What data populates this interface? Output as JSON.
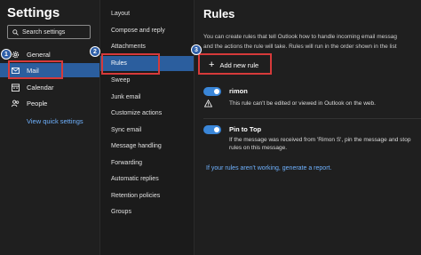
{
  "settings": {
    "title": "Settings",
    "search_placeholder": "Search settings",
    "nav": [
      {
        "label": "General",
        "icon": "gear-icon"
      },
      {
        "label": "Mail",
        "icon": "mail-icon",
        "selected": true
      },
      {
        "label": "Calendar",
        "icon": "calendar-icon"
      },
      {
        "label": "People",
        "icon": "people-icon"
      }
    ],
    "quick_settings_link": "View quick settings"
  },
  "mail_nav": [
    {
      "label": "Layout"
    },
    {
      "label": "Compose and reply"
    },
    {
      "label": "Attachments"
    },
    {
      "label": "Rules",
      "selected": true
    },
    {
      "label": "Sweep"
    },
    {
      "label": "Junk email"
    },
    {
      "label": "Customize actions"
    },
    {
      "label": "Sync email"
    },
    {
      "label": "Message handling"
    },
    {
      "label": "Forwarding"
    },
    {
      "label": "Automatic replies"
    },
    {
      "label": "Retention policies"
    },
    {
      "label": "Groups"
    }
  ],
  "rules": {
    "title": "Rules",
    "description_line1": "You can create rules that tell Outlook how to handle incoming email messag",
    "description_line2": "and the actions the rule will take. Rules will run in the order shown in the list",
    "add_rule_label": "Add new rule",
    "items": [
      {
        "name": "rimon",
        "enabled": true,
        "message_lines": [
          "This rule can't be edited or viewed in Outlook on the web."
        ],
        "warning": true
      },
      {
        "name": "Pin to Top",
        "enabled": true,
        "message_lines": [
          "If the message was received from 'Rimon S', pin the message and stop",
          "rules on this message."
        ],
        "warning": false
      }
    ],
    "report_link": "If your rules aren't working, generate a report."
  },
  "annotations": {
    "badges": [
      "1",
      "2",
      "3"
    ],
    "highlight_color": "#d63a3a"
  },
  "colors": {
    "accent": "#2b5e9e",
    "link": "#6fb2ff",
    "toggle_on": "#3a86d8"
  }
}
